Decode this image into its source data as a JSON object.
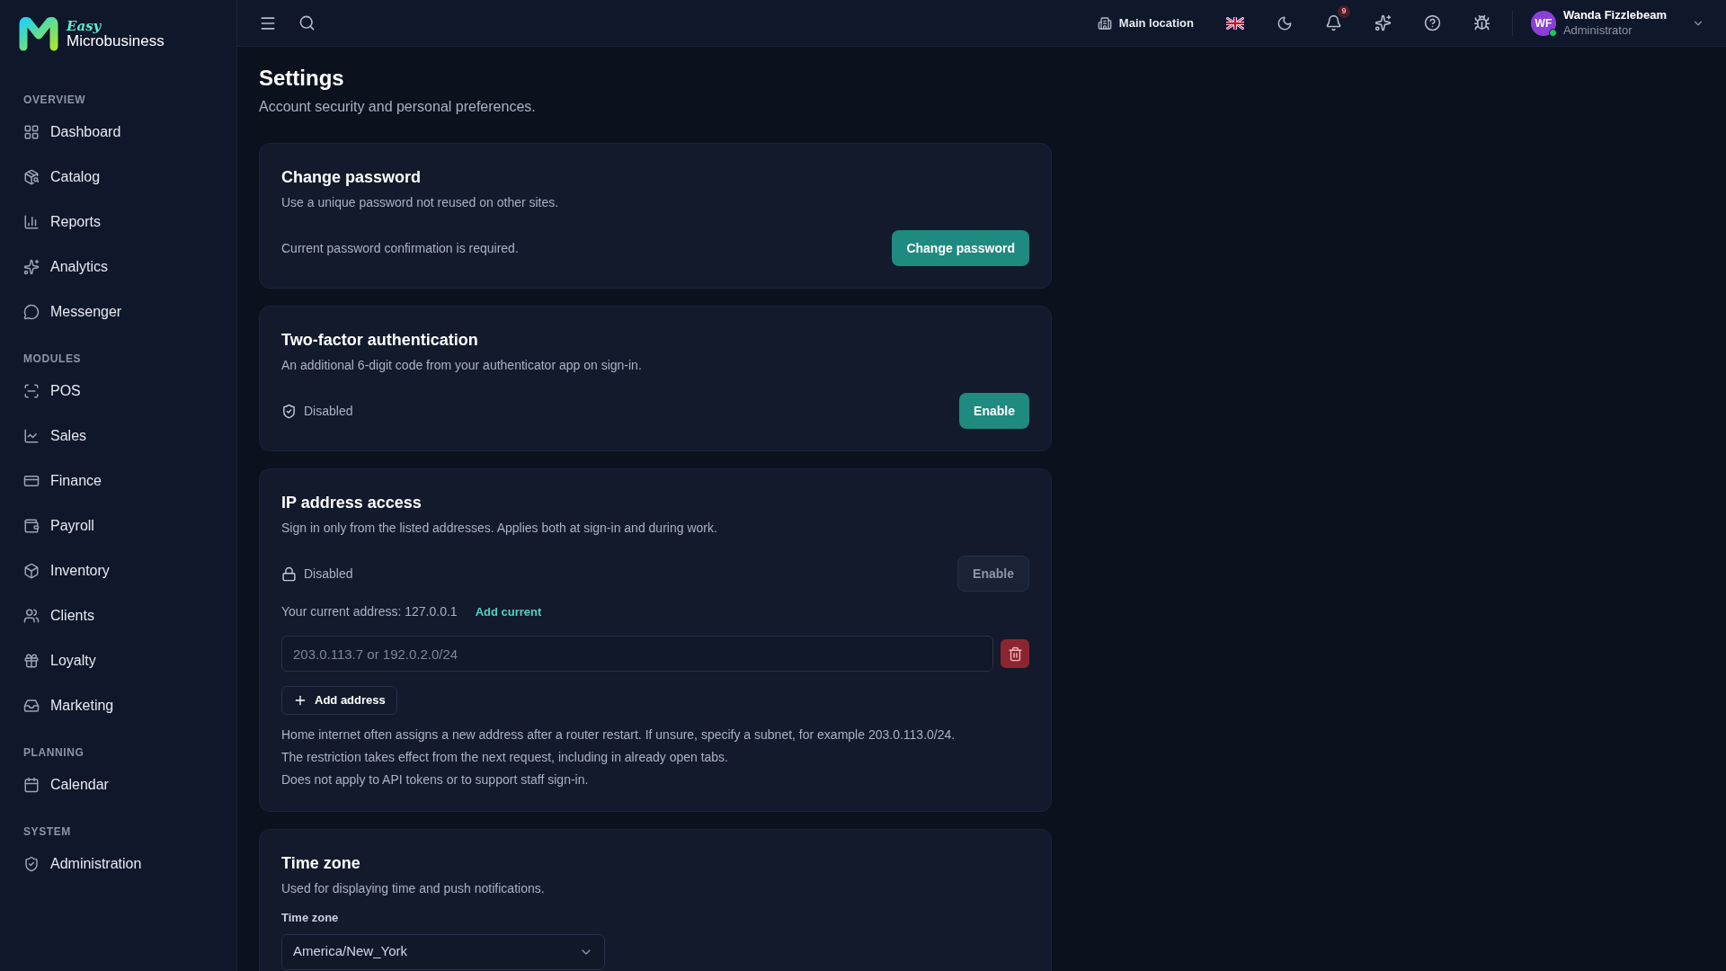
{
  "brand": {
    "line_1": "Easy",
    "line_2": "Microbusiness"
  },
  "sidebar": {
    "sections": [
      {
        "heading": "OVERVIEW",
        "items": [
          {
            "label": "Dashboard"
          },
          {
            "label": "Catalog"
          },
          {
            "label": "Reports"
          },
          {
            "label": "Analytics"
          },
          {
            "label": "Messenger"
          }
        ]
      },
      {
        "heading": "MODULES",
        "items": [
          {
            "label": "POS"
          },
          {
            "label": "Sales"
          },
          {
            "label": "Finance"
          },
          {
            "label": "Payroll"
          },
          {
            "label": "Inventory"
          },
          {
            "label": "Clients"
          },
          {
            "label": "Loyalty"
          },
          {
            "label": "Marketing"
          }
        ]
      },
      {
        "heading": "PLANNING",
        "items": [
          {
            "label": "Calendar"
          }
        ]
      },
      {
        "heading": "SYSTEM",
        "items": [
          {
            "label": "Administration"
          }
        ]
      }
    ]
  },
  "topbar": {
    "location": "Main location",
    "notifications_badge": "9",
    "user": {
      "initials": "WF",
      "name": "Wanda Fizzlebeam",
      "role": "Administrator",
      "online": true
    }
  },
  "page": {
    "title": "Settings",
    "subtitle": "Account security and personal preferences."
  },
  "cards": [
    {
      "kind": "password",
      "title": "Change password",
      "description": "Use a unique password not reused on other sites.",
      "note": "Current password confirmation is required.",
      "button": {
        "label": "Change password",
        "disabled": false
      }
    },
    {
      "kind": "twofactor",
      "title": "Two-factor authentication",
      "description": "An additional 6-digit code from your authenticator app on sign-in.",
      "status": "Disabled",
      "button": {
        "label": "Enable",
        "disabled": false
      }
    },
    {
      "kind": "ip",
      "title": "IP address access",
      "description": "Sign in only from the listed addresses. Applies both at sign-in and during work.",
      "status": "Disabled",
      "button": {
        "label": "Enable",
        "disabled": true
      },
      "current_address": "Your current address: 127.0.0.1",
      "add_current": "Add current",
      "address_placeholder": "203.0.113.7 or 192.0.2.0/24",
      "add_address": "Add address",
      "notes": [
        "Home internet often assigns a new address after a router restart. If unsure, specify a subnet, for example 203.0.113.0/24.",
        "The restriction takes effect from the next request, including in already open tabs.",
        "Does not apply to API tokens or to support staff sign-in."
      ]
    },
    {
      "kind": "timezone",
      "title": "Time zone",
      "description": "Used for displaying time and push notifications.",
      "field_label": "Time zone",
      "value": "America/New_York"
    }
  ]
}
